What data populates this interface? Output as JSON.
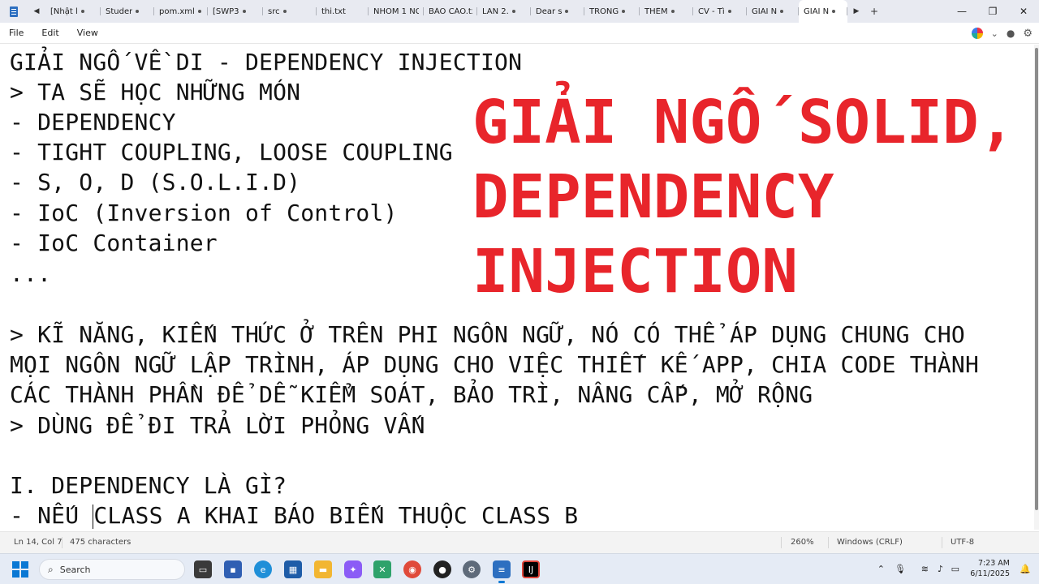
{
  "window": {
    "tabs": [
      {
        "label": "[Nhật l",
        "modified": true
      },
      {
        "label": "Studer",
        "modified": true
      },
      {
        "label": "pom.xml",
        "modified": true
      },
      {
        "label": "[SWP3",
        "modified": true
      },
      {
        "label": "src",
        "modified": true
      },
      {
        "label": "thi.txt",
        "modified": false
      },
      {
        "label": "NHÓM 1 NG",
        "modified": false
      },
      {
        "label": "BÁO CÁO.txt",
        "modified": false
      },
      {
        "label": "LAN 2.",
        "modified": true
      },
      {
        "label": "Dear s",
        "modified": true
      },
      {
        "label": "TRONG",
        "modified": true
      },
      {
        "label": "THÊM",
        "modified": true
      },
      {
        "label": "CV - Tì",
        "modified": true
      },
      {
        "label": "GIẢI N",
        "modified": true
      },
      {
        "label": "GIẢI N",
        "modified": true
      }
    ],
    "new_tab_label": "+",
    "minimize": "—",
    "maximize": "❐",
    "close": "✕"
  },
  "menu": {
    "file": "File",
    "edit": "Edit",
    "view": "View"
  },
  "editor": {
    "lines": [
      "GIẢI NGỐ VỀ DI - DEPENDENCY INJECTION",
      "> TA SẼ HỌC NHỮNG MÓN",
      "- DEPENDENCY",
      "- TIGHT COUPLING, LOOSE COUPLING",
      "- S, O, D (S.O.L.I.D)",
      "- IoC (Inversion of Control)",
      "- IoC Container",
      "...",
      "",
      "> KĨ NĂNG, KIẾN THỨC Ở TRÊN PHI NGÔN NGỮ, NÓ CÓ THỂ ÁP DỤNG CHUNG CHO",
      "MỌI NGÔN NGỮ LẬP TRÌNH, ÁP DỤNG CHO VIỆC THIẾT KẾ APP, CHIA CODE THÀNH",
      "CÁC THÀNH PHẦN ĐỂ DỄ KIỂM SOÁT, BẢO TRÌ, NÂNG CẤP, MỞ RỘNG",
      "> DÙNG ĐỂ ĐI TRẢ LỜI PHỎNG VẤN",
      "",
      "I. DEPENDENCY LÀ GÌ?",
      "- NẾU CLASS A KHAI BÁO BIẾN THUỘC CLASS B"
    ],
    "caret_line_before": "- NẾU ",
    "caret_line_after": "CLASS A KHAI BÁO BIẾN THUỘC CLASS B",
    "overlay": {
      "line1": "GIẢI NGỐ SOLID,",
      "line2": "DEPENDENCY",
      "line3": "INJECTION",
      "color": "#e8252b"
    }
  },
  "status": {
    "position": "Ln 14, Col 7",
    "characters": "475 characters",
    "zoom": "260%",
    "line_ending": "Windows (CRLF)",
    "encoding": "UTF-8"
  },
  "taskbar": {
    "search_placeholder": "Search",
    "time": "7:23 AM",
    "date": "6/11/2025"
  }
}
